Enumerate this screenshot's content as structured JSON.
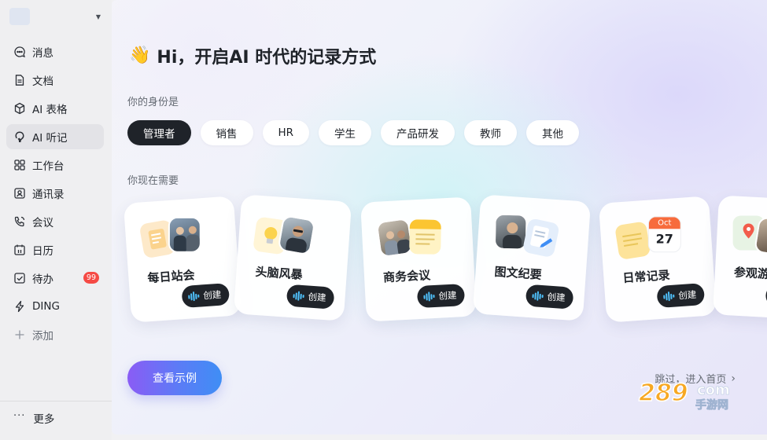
{
  "sidebar": {
    "items": [
      {
        "label": "消息",
        "icon": "chat-icon"
      },
      {
        "label": "文档",
        "icon": "document-icon"
      },
      {
        "label": "AI 表格",
        "icon": "cube-icon"
      },
      {
        "label": "AI 听记",
        "icon": "ai-listen-icon",
        "active": true
      },
      {
        "label": "工作台",
        "icon": "grid-icon"
      },
      {
        "label": "通讯录",
        "icon": "contacts-icon"
      },
      {
        "label": "会议",
        "icon": "phone-icon"
      },
      {
        "label": "日历",
        "icon": "calendar-icon"
      },
      {
        "label": "待办",
        "icon": "todo-icon",
        "badge": "99"
      },
      {
        "label": "DING",
        "icon": "lightning-icon"
      },
      {
        "label": "添加",
        "icon": "plus-icon"
      }
    ],
    "more_label": "更多"
  },
  "main": {
    "greeting_emoji": "👋",
    "greeting": "Hi，开启AI 时代的记录方式",
    "identity_label": "你的身份是",
    "roles": [
      "管理者",
      "销售",
      "HR",
      "学生",
      "产品研发",
      "教师",
      "其他"
    ],
    "selected_role": "管理者",
    "needs_label": "你现在需要",
    "cards": [
      {
        "title": "每日站会",
        "button": "创建"
      },
      {
        "title": "头脑风暴",
        "button": "创建"
      },
      {
        "title": "商务会议",
        "button": "创建"
      },
      {
        "title": "图文纪要",
        "button": "创建"
      },
      {
        "title": "日常记录",
        "button": "创建"
      },
      {
        "title": "参观游览",
        "button": "创建"
      }
    ],
    "calendar_month": "Oct",
    "calendar_day": "27",
    "cta_label": "查看示例",
    "skip_label": "跳过，进入首页",
    "watermark_main": "289",
    "watermark_com": "com",
    "watermark_sub": "手游网"
  },
  "colors": {
    "accent_dark": "#1f2329",
    "badge_red": "#f54a45",
    "cta_start": "#8a5cf5",
    "cta_end": "#3f8ef5"
  }
}
